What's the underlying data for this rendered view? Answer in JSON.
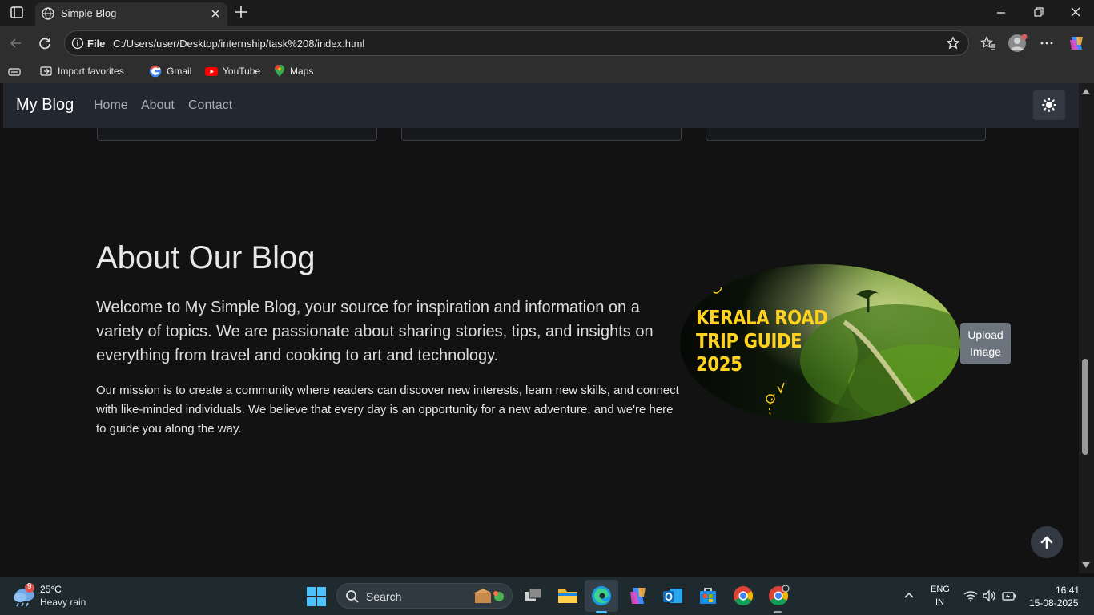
{
  "browser": {
    "tab_title": "Simple Blog",
    "url_scheme": "File",
    "url": "C:/Users/user/Desktop/internship/task%208/index.html",
    "favorites": [
      {
        "label": "Import favorites",
        "icon": "import-icon"
      },
      {
        "label": "Gmail",
        "icon": "google-icon"
      },
      {
        "label": "YouTube",
        "icon": "youtube-icon"
      },
      {
        "label": "Maps",
        "icon": "maps-icon"
      }
    ]
  },
  "navbar": {
    "brand": "My Blog",
    "links": [
      "Home",
      "About",
      "Contact"
    ],
    "theme_icon": "sun-icon"
  },
  "about": {
    "title": "About Our Blog",
    "lead": "Welcome to My Simple Blog, your source for inspiration and information on a variety of topics. We are passionate about sharing stories, tips, and insights on everything from travel and cooking to art and technology.",
    "body": "Our mission is to create a community where readers can discover new interests, learn new skills, and connect with like-minded individuals. We believe that every day is an opportunity for a new adventure, and we're here to guide you along the way.",
    "image_text": [
      "KERALA ROAD",
      "TRIP GUIDE",
      "2025"
    ],
    "upload_label_1": "Upload",
    "upload_label_2": "Image"
  },
  "taskbar": {
    "weather_badge": "9",
    "temperature": "25°C",
    "weather": "Heavy rain",
    "search_placeholder": "Search",
    "lang_1": "ENG",
    "lang_2": "IN",
    "time": "16:41",
    "date": "15-08-2025"
  },
  "colors": {
    "page_bg": "#121212",
    "navbar_bg": "#232730",
    "upload_btn": "#6c757d",
    "image_text": "#ffd21f"
  }
}
